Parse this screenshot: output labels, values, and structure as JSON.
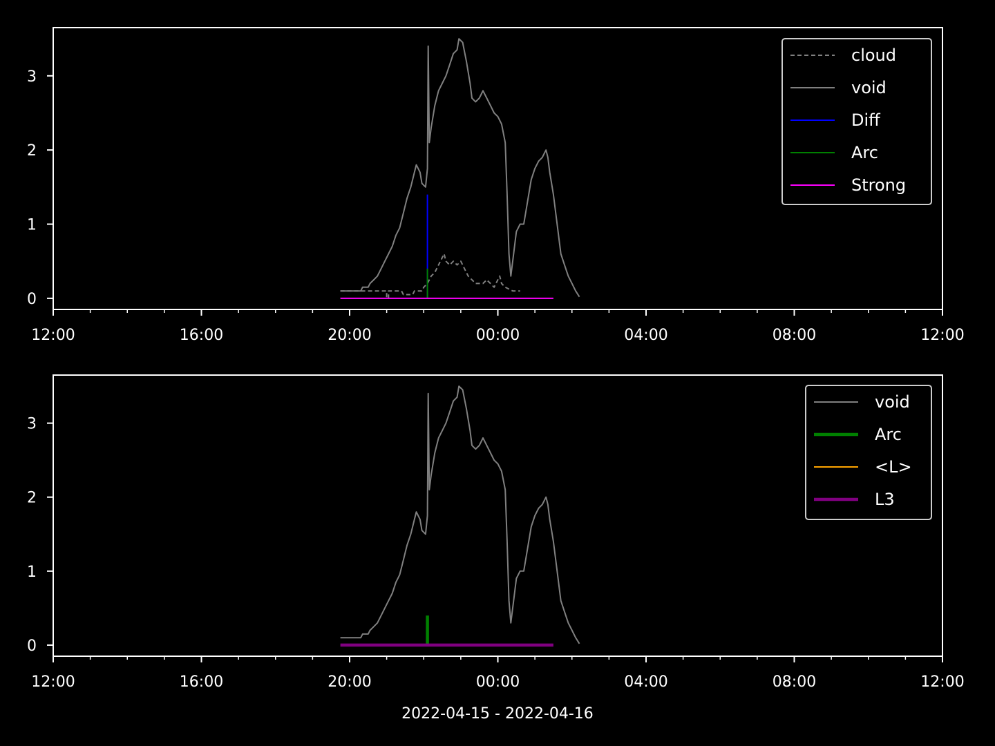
{
  "colors": {
    "background": "#000000",
    "axes": "#ffffff",
    "cloud": "#808080",
    "void": "#808080",
    "Diff": "#0000ff",
    "Arc": "#008000",
    "Strong": "#ff00ff",
    "<L>": "#ffa500",
    "L3": "#800080"
  },
  "xlabel": "2022-04-15 - 2022-04-16",
  "chart_data": [
    {
      "type": "line",
      "x_unit": "hours since 2022-04-15 12:00",
      "x_ticks": [
        "12:00",
        "16:00",
        "20:00",
        "00:00",
        "04:00",
        "08:00",
        "12:00"
      ],
      "x_tick_values": [
        0,
        4,
        8,
        12,
        16,
        20,
        24
      ],
      "xlim": [
        0,
        24
      ],
      "ylim": [
        -0.15,
        3.65
      ],
      "y_ticks": [
        "0",
        "1",
        "2",
        "3"
      ],
      "y_tick_values": [
        0,
        1,
        2,
        3
      ],
      "legend": "top-right",
      "series": [
        {
          "name": "cloud",
          "style": "dashed",
          "color": "#808080",
          "points": [
            [
              7.75,
              0.1
            ],
            [
              9.0,
              0.1
            ],
            [
              9.0,
              0.0
            ],
            [
              9.05,
              0.0
            ],
            [
              9.05,
              0.1
            ],
            [
              9.4,
              0.1
            ],
            [
              9.45,
              0.05
            ],
            [
              9.7,
              0.05
            ],
            [
              9.75,
              0.1
            ],
            [
              9.95,
              0.1
            ],
            [
              10.0,
              0.15
            ],
            [
              10.1,
              0.2
            ],
            [
              10.2,
              0.3
            ],
            [
              10.3,
              0.35
            ],
            [
              10.4,
              0.45
            ],
            [
              10.5,
              0.55
            ],
            [
              10.55,
              0.6
            ],
            [
              10.6,
              0.5
            ],
            [
              10.7,
              0.45
            ],
            [
              10.8,
              0.5
            ],
            [
              10.9,
              0.45
            ],
            [
              11.0,
              0.5
            ],
            [
              11.1,
              0.4
            ],
            [
              11.2,
              0.3
            ],
            [
              11.3,
              0.25
            ],
            [
              11.4,
              0.2
            ],
            [
              11.6,
              0.2
            ],
            [
              11.7,
              0.25
            ],
            [
              11.8,
              0.2
            ],
            [
              11.9,
              0.15
            ],
            [
              12.0,
              0.25
            ],
            [
              12.05,
              0.3
            ],
            [
              12.1,
              0.2
            ],
            [
              12.2,
              0.15
            ],
            [
              12.4,
              0.1
            ],
            [
              12.6,
              0.1
            ]
          ]
        },
        {
          "name": "void",
          "style": "solid",
          "color": "#808080",
          "points": [
            [
              7.75,
              0.1
            ],
            [
              8.3,
              0.1
            ],
            [
              8.35,
              0.15
            ],
            [
              8.5,
              0.15
            ],
            [
              8.55,
              0.2
            ],
            [
              8.65,
              0.25
            ],
            [
              8.75,
              0.3
            ],
            [
              8.85,
              0.4
            ],
            [
              8.95,
              0.5
            ],
            [
              9.05,
              0.6
            ],
            [
              9.15,
              0.7
            ],
            [
              9.25,
              0.85
            ],
            [
              9.35,
              0.95
            ],
            [
              9.45,
              1.15
            ],
            [
              9.55,
              1.35
            ],
            [
              9.65,
              1.5
            ],
            [
              9.75,
              1.7
            ],
            [
              9.8,
              1.8
            ],
            [
              9.9,
              1.7
            ],
            [
              9.95,
              1.55
            ],
            [
              10.05,
              1.5
            ],
            [
              10.1,
              1.75
            ],
            [
              10.12,
              3.4
            ],
            [
              10.15,
              2.1
            ],
            [
              10.2,
              2.3
            ],
            [
              10.3,
              2.6
            ],
            [
              10.4,
              2.8
            ],
            [
              10.5,
              2.9
            ],
            [
              10.6,
              3.0
            ],
            [
              10.7,
              3.15
            ],
            [
              10.8,
              3.3
            ],
            [
              10.9,
              3.35
            ],
            [
              10.95,
              3.5
            ],
            [
              11.05,
              3.45
            ],
            [
              11.15,
              3.2
            ],
            [
              11.25,
              2.9
            ],
            [
              11.3,
              2.7
            ],
            [
              11.4,
              2.65
            ],
            [
              11.5,
              2.7
            ],
            [
              11.6,
              2.8
            ],
            [
              11.7,
              2.7
            ],
            [
              11.8,
              2.6
            ],
            [
              11.9,
              2.5
            ],
            [
              12.0,
              2.45
            ],
            [
              12.1,
              2.35
            ],
            [
              12.2,
              2.1
            ],
            [
              12.25,
              1.4
            ],
            [
              12.3,
              0.6
            ],
            [
              12.35,
              0.3
            ],
            [
              12.4,
              0.5
            ],
            [
              12.5,
              0.9
            ],
            [
              12.6,
              1.0
            ],
            [
              12.7,
              1.0
            ],
            [
              12.8,
              1.3
            ],
            [
              12.9,
              1.6
            ],
            [
              13.0,
              1.75
            ],
            [
              13.1,
              1.85
            ],
            [
              13.2,
              1.9
            ],
            [
              13.25,
              1.95
            ],
            [
              13.3,
              2.0
            ],
            [
              13.35,
              1.9
            ],
            [
              13.4,
              1.7
            ],
            [
              13.5,
              1.4
            ],
            [
              13.6,
              1.0
            ],
            [
              13.7,
              0.6
            ],
            [
              13.8,
              0.45
            ],
            [
              13.9,
              0.3
            ],
            [
              14.0,
              0.2
            ],
            [
              14.1,
              0.1
            ],
            [
              14.2,
              0.02
            ]
          ]
        },
        {
          "name": "Diff",
          "style": "solid",
          "color": "#0000ff",
          "points": [
            [
              10.1,
              1.4
            ],
            [
              10.1,
              0.0
            ]
          ]
        },
        {
          "name": "Arc",
          "style": "solid",
          "color": "#008000",
          "points": [
            [
              10.1,
              0.4
            ],
            [
              10.1,
              0.0
            ]
          ]
        },
        {
          "name": "Strong",
          "style": "solid",
          "color": "#ff00ff",
          "points": [
            [
              7.75,
              0.0
            ],
            [
              13.5,
              0.0
            ]
          ]
        }
      ]
    },
    {
      "type": "line",
      "x_unit": "hours since 2022-04-15 12:00",
      "x_ticks": [
        "12:00",
        "16:00",
        "20:00",
        "00:00",
        "04:00",
        "08:00",
        "12:00"
      ],
      "x_tick_values": [
        0,
        4,
        8,
        12,
        16,
        20,
        24
      ],
      "xlim": [
        0,
        24
      ],
      "ylim": [
        -0.15,
        3.65
      ],
      "y_ticks": [
        "0",
        "1",
        "2",
        "3"
      ],
      "y_tick_values": [
        0,
        1,
        2,
        3
      ],
      "legend": "top-right",
      "series": [
        {
          "name": "void",
          "style": "solid",
          "color": "#808080",
          "points": [
            [
              7.75,
              0.1
            ],
            [
              8.3,
              0.1
            ],
            [
              8.35,
              0.15
            ],
            [
              8.5,
              0.15
            ],
            [
              8.55,
              0.2
            ],
            [
              8.65,
              0.25
            ],
            [
              8.75,
              0.3
            ],
            [
              8.85,
              0.4
            ],
            [
              8.95,
              0.5
            ],
            [
              9.05,
              0.6
            ],
            [
              9.15,
              0.7
            ],
            [
              9.25,
              0.85
            ],
            [
              9.35,
              0.95
            ],
            [
              9.45,
              1.15
            ],
            [
              9.55,
              1.35
            ],
            [
              9.65,
              1.5
            ],
            [
              9.75,
              1.7
            ],
            [
              9.8,
              1.8
            ],
            [
              9.9,
              1.7
            ],
            [
              9.95,
              1.55
            ],
            [
              10.05,
              1.5
            ],
            [
              10.1,
              1.75
            ],
            [
              10.12,
              3.4
            ],
            [
              10.15,
              2.1
            ],
            [
              10.2,
              2.3
            ],
            [
              10.3,
              2.6
            ],
            [
              10.4,
              2.8
            ],
            [
              10.5,
              2.9
            ],
            [
              10.6,
              3.0
            ],
            [
              10.7,
              3.15
            ],
            [
              10.8,
              3.3
            ],
            [
              10.9,
              3.35
            ],
            [
              10.95,
              3.5
            ],
            [
              11.05,
              3.45
            ],
            [
              11.15,
              3.2
            ],
            [
              11.25,
              2.9
            ],
            [
              11.3,
              2.7
            ],
            [
              11.4,
              2.65
            ],
            [
              11.5,
              2.7
            ],
            [
              11.6,
              2.8
            ],
            [
              11.7,
              2.7
            ],
            [
              11.8,
              2.6
            ],
            [
              11.9,
              2.5
            ],
            [
              12.0,
              2.45
            ],
            [
              12.1,
              2.35
            ],
            [
              12.2,
              2.1
            ],
            [
              12.25,
              1.4
            ],
            [
              12.3,
              0.6
            ],
            [
              12.35,
              0.3
            ],
            [
              12.4,
              0.5
            ],
            [
              12.5,
              0.9
            ],
            [
              12.6,
              1.0
            ],
            [
              12.7,
              1.0
            ],
            [
              12.8,
              1.3
            ],
            [
              12.9,
              1.6
            ],
            [
              13.0,
              1.75
            ],
            [
              13.1,
              1.85
            ],
            [
              13.2,
              1.9
            ],
            [
              13.25,
              1.95
            ],
            [
              13.3,
              2.0
            ],
            [
              13.35,
              1.9
            ],
            [
              13.4,
              1.7
            ],
            [
              13.5,
              1.4
            ],
            [
              13.6,
              1.0
            ],
            [
              13.7,
              0.6
            ],
            [
              13.8,
              0.45
            ],
            [
              13.9,
              0.3
            ],
            [
              14.0,
              0.2
            ],
            [
              14.1,
              0.1
            ],
            [
              14.2,
              0.02
            ]
          ]
        },
        {
          "name": "Arc",
          "style": "thick",
          "color": "#008000",
          "points": [
            [
              10.1,
              0.4
            ],
            [
              10.1,
              0.0
            ]
          ]
        },
        {
          "name": "<L>",
          "style": "solid",
          "color": "#ffa500",
          "points": []
        },
        {
          "name": "L3",
          "style": "thick",
          "color": "#800080",
          "points": [
            [
              7.75,
              0.0
            ],
            [
              13.5,
              0.0
            ]
          ]
        }
      ]
    }
  ]
}
